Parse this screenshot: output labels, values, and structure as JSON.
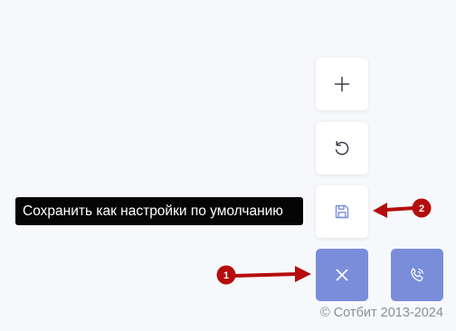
{
  "buttons": {
    "add": {
      "icon": "plus-icon"
    },
    "reset": {
      "icon": "reset-icon"
    },
    "save": {
      "icon": "floppy-disk-icon"
    },
    "close": {
      "icon": "close-icon"
    },
    "phone": {
      "icon": "phone-icon"
    }
  },
  "tooltip": {
    "text": "Сохранить как настройки по умолчанию"
  },
  "annotations": [
    {
      "label": "1"
    },
    {
      "label": "2"
    }
  ],
  "footer": {
    "copyright": "© Сотбит 2013-2024"
  },
  "colors": {
    "accent": "#7a8ddb",
    "annotation": "#b50d0d",
    "page_background": "#f7f8fb",
    "tooltip_background": "#050505"
  }
}
